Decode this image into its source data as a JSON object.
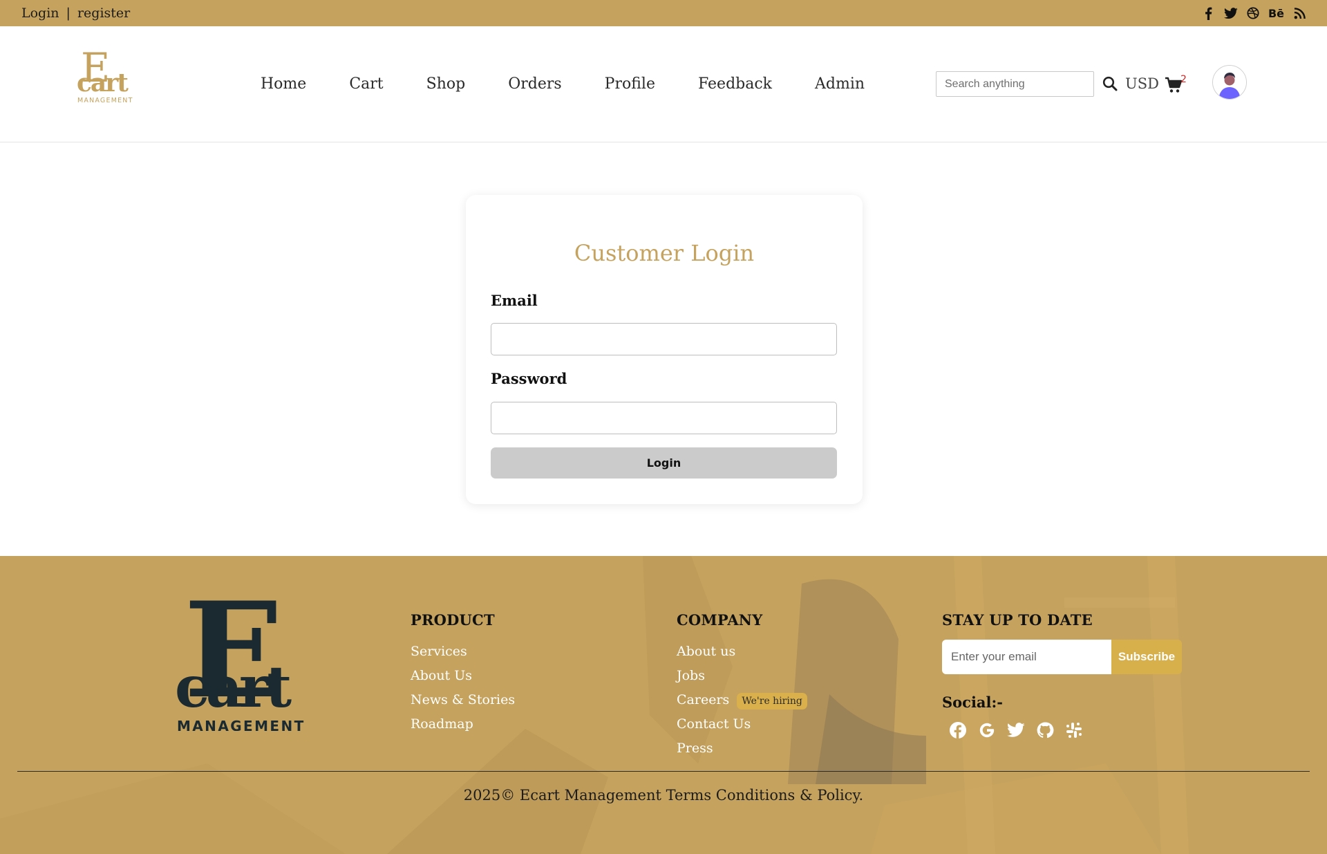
{
  "topbar": {
    "login_label": "Login",
    "separator": "|",
    "register_label": "register",
    "socials": [
      "facebook-icon",
      "twitter-icon",
      "dribbble-icon",
      "behance-icon",
      "rss-icon"
    ],
    "behance_text": "Bē"
  },
  "brand": {
    "logo_letter": "E",
    "logo_word": "cart",
    "logo_sub": "MANAGEMENT"
  },
  "nav": {
    "items": [
      "Home",
      "Cart",
      "Shop",
      "Orders",
      "Profile",
      "Feedback",
      "Admin"
    ]
  },
  "header": {
    "search_placeholder": "Search anything",
    "currency": "USD",
    "cart_count": "2"
  },
  "login": {
    "title": "Customer Login",
    "email_label": "Email",
    "email_value": "",
    "password_label": "Password",
    "password_value": "",
    "submit_label": "Login"
  },
  "footer": {
    "product": {
      "heading": "PRODUCT",
      "links": [
        "Services",
        "About Us",
        "News & Stories",
        "Roadmap"
      ]
    },
    "company": {
      "heading": "COMPANY",
      "links": [
        "About us",
        "Jobs",
        "Careers",
        "Contact Us",
        "Press"
      ],
      "hiring_badge": "We're hiring"
    },
    "stay": {
      "heading": "STAY UP TO DATE",
      "email_placeholder": "Enter your email",
      "subscribe_label": "Subscribe",
      "social_title": "Social:-",
      "social_icons": [
        "facebook-icon",
        "google-icon",
        "twitter-icon",
        "github-icon",
        "slack-icon"
      ]
    },
    "copyright": "2025© Ecart Management Terms Conditions & Policy."
  },
  "colors": {
    "brand_gold": "#c5a25d",
    "accent_gold": "#d8b04b",
    "logo_dark": "#1b2a30",
    "cart_badge": "#d21f1f"
  }
}
